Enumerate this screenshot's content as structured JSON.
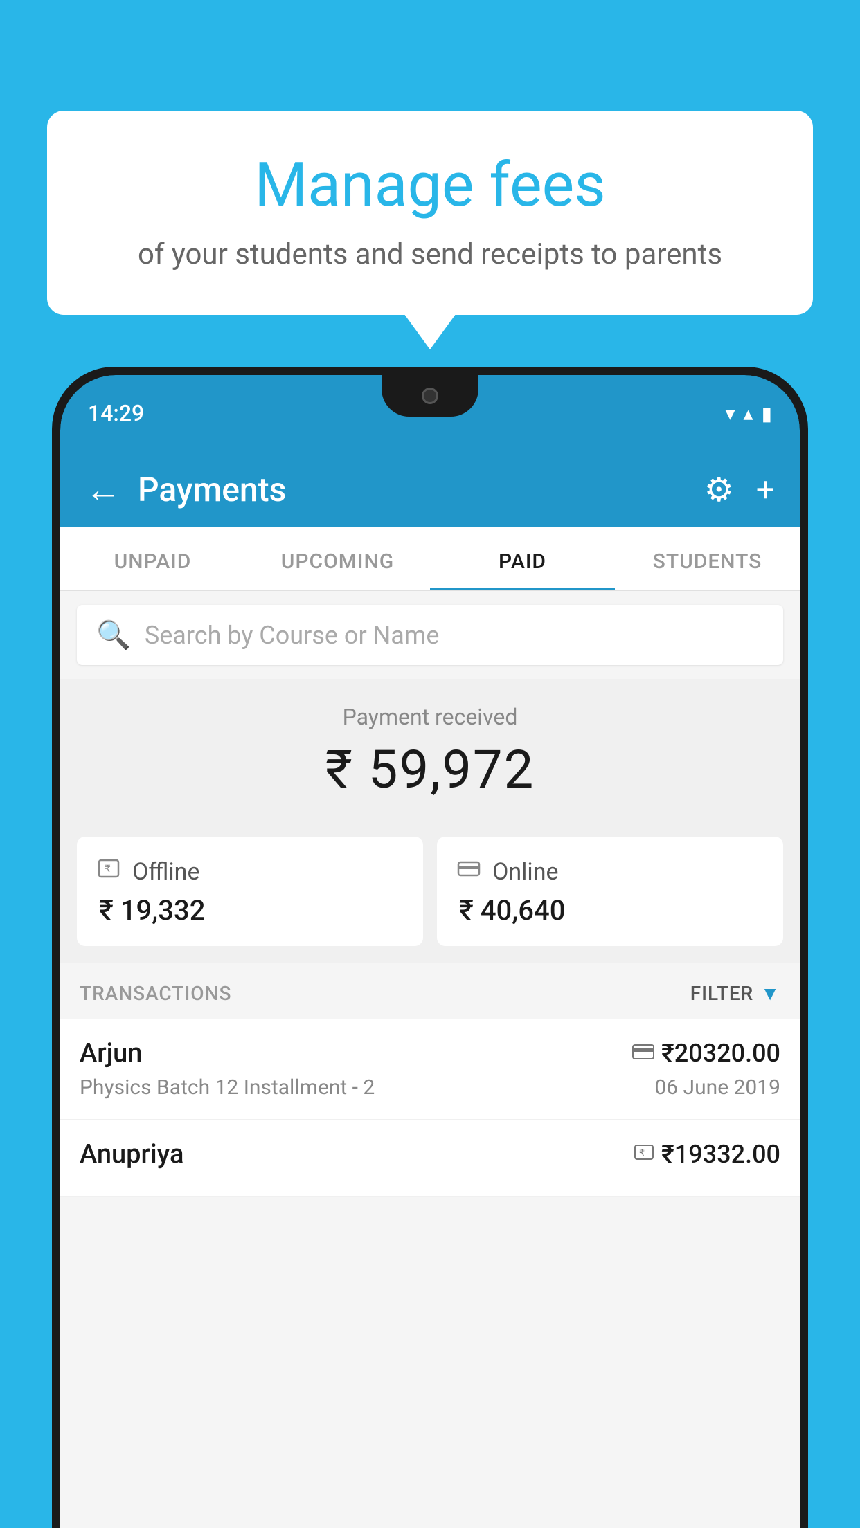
{
  "background_color": "#29B6E8",
  "speech_bubble": {
    "title": "Manage fees",
    "subtitle": "of your students and send receipts to parents"
  },
  "status_bar": {
    "time": "14:29",
    "wifi": "▾",
    "signal": "▴",
    "battery": "▮"
  },
  "top_bar": {
    "title": "Payments",
    "back_label": "←",
    "gear_label": "⚙",
    "plus_label": "+"
  },
  "tabs": [
    {
      "label": "UNPAID",
      "active": false
    },
    {
      "label": "UPCOMING",
      "active": false
    },
    {
      "label": "PAID",
      "active": true
    },
    {
      "label": "STUDENTS",
      "active": false
    }
  ],
  "search": {
    "placeholder": "Search by Course or Name"
  },
  "summary": {
    "label": "Payment received",
    "amount": "₹ 59,972",
    "offline": {
      "label": "Offline",
      "amount": "₹ 19,332"
    },
    "online": {
      "label": "Online",
      "amount": "₹ 40,640"
    }
  },
  "transactions": {
    "header_label": "TRANSACTIONS",
    "filter_label": "FILTER",
    "rows": [
      {
        "name": "Arjun",
        "course": "Physics Batch 12 Installment - 2",
        "amount": "₹20320.00",
        "date": "06 June 2019",
        "payment_type": "online"
      },
      {
        "name": "Anupriya",
        "course": "",
        "amount": "₹19332.00",
        "date": "",
        "payment_type": "offline"
      }
    ]
  }
}
